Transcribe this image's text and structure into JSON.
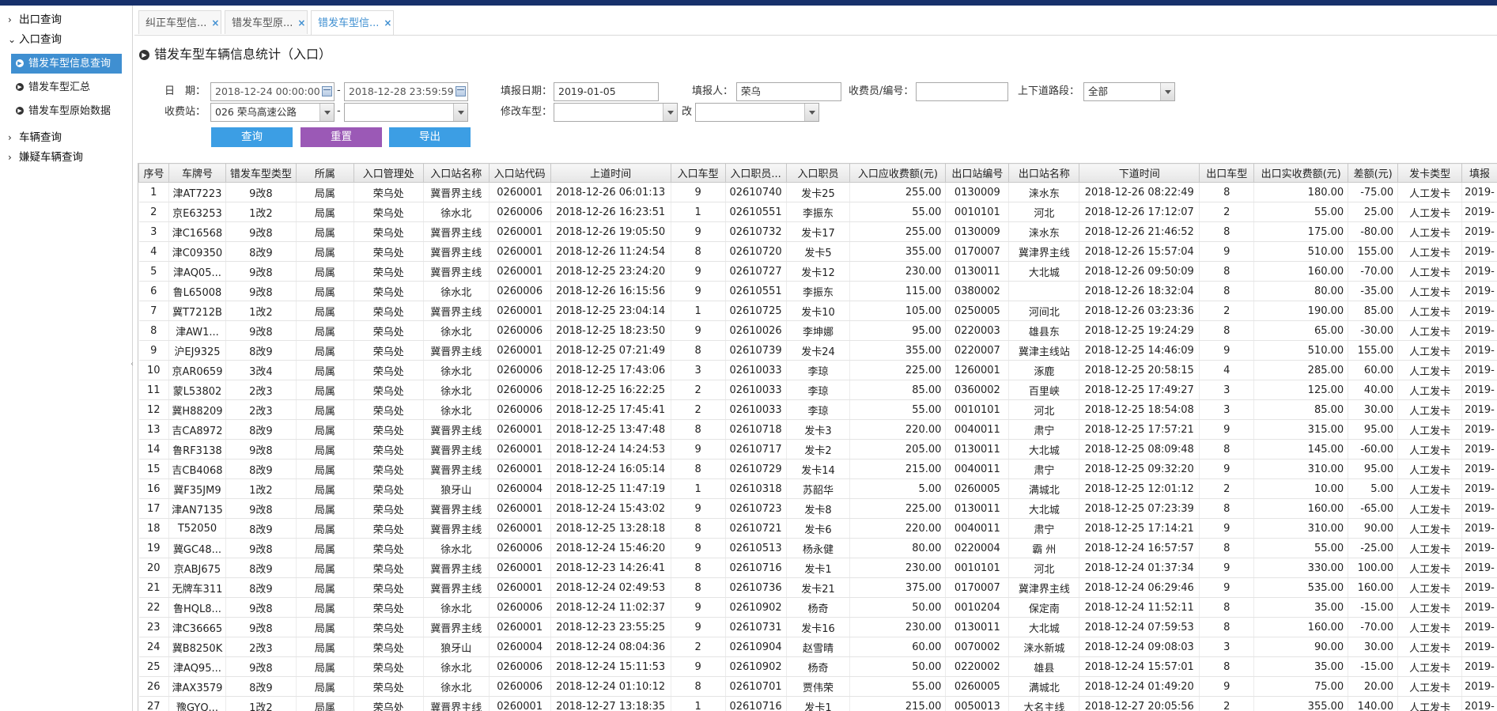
{
  "sidebar": {
    "items": [
      {
        "label": "出口查询",
        "chevron": "›"
      },
      {
        "label": "入口查询",
        "chevron": "⌄"
      },
      {
        "label": "车辆查询",
        "chevron": "›"
      },
      {
        "label": "嫌疑车辆查询",
        "chevron": "›"
      }
    ],
    "sub_items": [
      {
        "label": "错发车型信息查询",
        "active": true
      },
      {
        "label": "错发车型汇总",
        "active": false
      },
      {
        "label": "错发车型原始数据",
        "active": false
      }
    ]
  },
  "tabs": [
    {
      "label": "纠正车型信...",
      "close": "×"
    },
    {
      "label": "错发车型原...",
      "close": "×"
    },
    {
      "label": "错发车型信...",
      "close": "×"
    }
  ],
  "page": {
    "title": "错发车型车辆信息统计（入口）"
  },
  "form": {
    "date_label": "日　期：",
    "date_from": "2018-12-24 00:00:00",
    "date_to": "2018-12-28 23:59:59",
    "dash": "-",
    "report_date_label": "填报日期：",
    "report_date": "2019-01-05",
    "reporter_label": "填报人：",
    "reporter": "荣乌",
    "collector_label": "收费员/编号：",
    "collector": "",
    "section_label": "上下道路段：",
    "section": "全部",
    "station_label": "收费站：",
    "station": "026 荣乌高速公路",
    "station2": "",
    "modify_label": "修改车型：",
    "modify_from": "",
    "modify_to_label": "改",
    "modify_to": "",
    "query_button": "查询",
    "reset_button": "重置",
    "export_button": "导出"
  },
  "table": {
    "columns": [
      "序号",
      "车牌号",
      "错发车型类型",
      "所属",
      "入口管理处",
      "入口站名称",
      "入口站代码",
      "上道时间",
      "入口车型",
      "入口职员...",
      "入口职员",
      "入口应收费额(元)",
      "出口站编号",
      "出口站名称",
      "下道时间",
      "出口车型",
      "出口实收费额(元)",
      "差额(元)",
      "发卡类型",
      "填报"
    ],
    "rows": [
      [
        "1",
        "津AT7223",
        "9改8",
        "局属",
        "荣乌处",
        "冀晋界主线",
        "0260001",
        "2018-12-26 06:01:13",
        "9",
        "02610740",
        "发卡25",
        "255.00",
        "0130009",
        "涞水东",
        "2018-12-26 08:22:49",
        "8",
        "180.00",
        "-75.00",
        "人工发卡",
        "2019-"
      ],
      [
        "2",
        "京E63253",
        "1改2",
        "局属",
        "荣乌处",
        "徐水北",
        "0260006",
        "2018-12-26 16:23:51",
        "1",
        "02610551",
        "李振东",
        "55.00",
        "0010101",
        "河北",
        "2018-12-26 17:12:07",
        "2",
        "55.00",
        "25.00",
        "人工发卡",
        "2019-"
      ],
      [
        "3",
        "津C16568",
        "9改8",
        "局属",
        "荣乌处",
        "冀晋界主线",
        "0260001",
        "2018-12-26 19:05:50",
        "9",
        "02610732",
        "发卡17",
        "255.00",
        "0130009",
        "涞水东",
        "2018-12-26 21:46:52",
        "8",
        "175.00",
        "-80.00",
        "人工发卡",
        "2019-"
      ],
      [
        "4",
        "津C09350",
        "8改9",
        "局属",
        "荣乌处",
        "冀晋界主线",
        "0260001",
        "2018-12-26 11:24:54",
        "8",
        "02610720",
        "发卡5",
        "355.00",
        "0170007",
        "冀津界主线",
        "2018-12-26 15:57:04",
        "9",
        "510.00",
        "155.00",
        "人工发卡",
        "2019-"
      ],
      [
        "5",
        "津AQ05...",
        "9改8",
        "局属",
        "荣乌处",
        "冀晋界主线",
        "0260001",
        "2018-12-25 23:24:20",
        "9",
        "02610727",
        "发卡12",
        "230.00",
        "0130011",
        "大北城",
        "2018-12-26 09:50:09",
        "8",
        "160.00",
        "-70.00",
        "人工发卡",
        "2019-"
      ],
      [
        "6",
        "鲁L65008",
        "9改8",
        "局属",
        "荣乌处",
        "徐水北",
        "0260006",
        "2018-12-26 16:15:56",
        "9",
        "02610551",
        "李振东",
        "115.00",
        "0380002",
        "",
        "2018-12-26 18:32:04",
        "8",
        "80.00",
        "-35.00",
        "人工发卡",
        "2019-"
      ],
      [
        "7",
        "冀T7212B",
        "1改2",
        "局属",
        "荣乌处",
        "冀晋界主线",
        "0260001",
        "2018-12-25 23:04:14",
        "1",
        "02610725",
        "发卡10",
        "105.00",
        "0250005",
        "河间北",
        "2018-12-26 03:23:36",
        "2",
        "190.00",
        "85.00",
        "人工发卡",
        "2019-"
      ],
      [
        "8",
        "津AW1...",
        "9改8",
        "局属",
        "荣乌处",
        "徐水北",
        "0260006",
        "2018-12-25 18:23:50",
        "9",
        "02610026",
        "李坤娜",
        "95.00",
        "0220003",
        "雄县东",
        "2018-12-25 19:24:29",
        "8",
        "65.00",
        "-30.00",
        "人工发卡",
        "2019-"
      ],
      [
        "9",
        "沪EJ9325",
        "8改9",
        "局属",
        "荣乌处",
        "冀晋界主线",
        "0260001",
        "2018-12-25 07:21:49",
        "8",
        "02610739",
        "发卡24",
        "355.00",
        "0220007",
        "冀津主线站",
        "2018-12-25 14:46:09",
        "9",
        "510.00",
        "155.00",
        "人工发卡",
        "2019-"
      ],
      [
        "10",
        "京AR0659",
        "3改4",
        "局属",
        "荣乌处",
        "徐水北",
        "0260006",
        "2018-12-25 17:43:06",
        "3",
        "02610033",
        "李琼",
        "225.00",
        "1260001",
        "涿鹿",
        "2018-12-25 20:58:15",
        "4",
        "285.00",
        "60.00",
        "人工发卡",
        "2019-"
      ],
      [
        "11",
        "蒙L53802",
        "2改3",
        "局属",
        "荣乌处",
        "徐水北",
        "0260006",
        "2018-12-25 16:22:25",
        "2",
        "02610033",
        "李琼",
        "85.00",
        "0360002",
        "百里峡",
        "2018-12-25 17:49:27",
        "3",
        "125.00",
        "40.00",
        "人工发卡",
        "2019-"
      ],
      [
        "12",
        "冀H88209",
        "2改3",
        "局属",
        "荣乌处",
        "徐水北",
        "0260006",
        "2018-12-25 17:45:41",
        "2",
        "02610033",
        "李琼",
        "55.00",
        "0010101",
        "河北",
        "2018-12-25 18:54:08",
        "3",
        "85.00",
        "30.00",
        "人工发卡",
        "2019-"
      ],
      [
        "13",
        "吉CA8972",
        "8改9",
        "局属",
        "荣乌处",
        "冀晋界主线",
        "0260001",
        "2018-12-25 13:47:48",
        "8",
        "02610718",
        "发卡3",
        "220.00",
        "0040011",
        "肃宁",
        "2018-12-25 17:57:21",
        "9",
        "315.00",
        "95.00",
        "人工发卡",
        "2019-"
      ],
      [
        "14",
        "鲁RF3138",
        "9改8",
        "局属",
        "荣乌处",
        "冀晋界主线",
        "0260001",
        "2018-12-24 14:24:53",
        "9",
        "02610717",
        "发卡2",
        "205.00",
        "0130011",
        "大北城",
        "2018-12-25 08:09:48",
        "8",
        "145.00",
        "-60.00",
        "人工发卡",
        "2019-"
      ],
      [
        "15",
        "吉CB4068",
        "8改9",
        "局属",
        "荣乌处",
        "冀晋界主线",
        "0260001",
        "2018-12-24 16:05:14",
        "8",
        "02610729",
        "发卡14",
        "215.00",
        "0040011",
        "肃宁",
        "2018-12-25 09:32:20",
        "9",
        "310.00",
        "95.00",
        "人工发卡",
        "2019-"
      ],
      [
        "16",
        "冀F35JM9",
        "1改2",
        "局属",
        "荣乌处",
        "狼牙山",
        "0260004",
        "2018-12-25 11:47:19",
        "1",
        "02610318",
        "苏韶华",
        "5.00",
        "0260005",
        "满城北",
        "2018-12-25 12:01:12",
        "2",
        "10.00",
        "5.00",
        "人工发卡",
        "2019-"
      ],
      [
        "17",
        "津AN7135",
        "9改8",
        "局属",
        "荣乌处",
        "冀晋界主线",
        "0260001",
        "2018-12-24 15:43:02",
        "9",
        "02610723",
        "发卡8",
        "225.00",
        "0130011",
        "大北城",
        "2018-12-25 07:23:39",
        "8",
        "160.00",
        "-65.00",
        "人工发卡",
        "2019-"
      ],
      [
        "18",
        "T52050",
        "8改9",
        "局属",
        "荣乌处",
        "冀晋界主线",
        "0260001",
        "2018-12-25 13:28:18",
        "8",
        "02610721",
        "发卡6",
        "220.00",
        "0040011",
        "肃宁",
        "2018-12-25 17:14:21",
        "9",
        "310.00",
        "90.00",
        "人工发卡",
        "2019-"
      ],
      [
        "19",
        "冀GC48...",
        "9改8",
        "局属",
        "荣乌处",
        "徐水北",
        "0260006",
        "2018-12-24 15:46:20",
        "9",
        "02610513",
        "杨永健",
        "80.00",
        "0220004",
        "霸 州",
        "2018-12-24 16:57:57",
        "8",
        "55.00",
        "-25.00",
        "人工发卡",
        "2019-"
      ],
      [
        "20",
        "京ABJ675",
        "8改9",
        "局属",
        "荣乌处",
        "冀晋界主线",
        "0260001",
        "2018-12-23 14:26:41",
        "8",
        "02610716",
        "发卡1",
        "230.00",
        "0010101",
        "河北",
        "2018-12-24 01:37:34",
        "9",
        "330.00",
        "100.00",
        "人工发卡",
        "2019-"
      ],
      [
        "21",
        "无牌车311",
        "8改9",
        "局属",
        "荣乌处",
        "冀晋界主线",
        "0260001",
        "2018-12-24 02:49:53",
        "8",
        "02610736",
        "发卡21",
        "375.00",
        "0170007",
        "冀津界主线",
        "2018-12-24 06:29:46",
        "9",
        "535.00",
        "160.00",
        "人工发卡",
        "2019-"
      ],
      [
        "22",
        "鲁HQL8...",
        "9改8",
        "局属",
        "荣乌处",
        "徐水北",
        "0260006",
        "2018-12-24 11:02:37",
        "9",
        "02610902",
        "杨奇",
        "50.00",
        "0010204",
        "保定南",
        "2018-12-24 11:52:11",
        "8",
        "35.00",
        "-15.00",
        "人工发卡",
        "2019-"
      ],
      [
        "23",
        "津C36665",
        "9改8",
        "局属",
        "荣乌处",
        "冀晋界主线",
        "0260001",
        "2018-12-23 23:55:25",
        "9",
        "02610731",
        "发卡16",
        "230.00",
        "0130011",
        "大北城",
        "2018-12-24 07:59:53",
        "8",
        "160.00",
        "-70.00",
        "人工发卡",
        "2019-"
      ],
      [
        "24",
        "冀B8250K",
        "2改3",
        "局属",
        "荣乌处",
        "狼牙山",
        "0260004",
        "2018-12-24 08:04:36",
        "2",
        "02610904",
        "赵雪晴",
        "60.00",
        "0070002",
        "涞水新城",
        "2018-12-24 09:08:03",
        "3",
        "90.00",
        "30.00",
        "人工发卡",
        "2019-"
      ],
      [
        "25",
        "津AQ95...",
        "9改8",
        "局属",
        "荣乌处",
        "徐水北",
        "0260006",
        "2018-12-24 15:11:53",
        "9",
        "02610902",
        "杨奇",
        "50.00",
        "0220002",
        "雄县",
        "2018-12-24 15:57:01",
        "8",
        "35.00",
        "-15.00",
        "人工发卡",
        "2019-"
      ],
      [
        "26",
        "津AX3579",
        "8改9",
        "局属",
        "荣乌处",
        "徐水北",
        "0260006",
        "2018-12-24 01:10:12",
        "8",
        "02610701",
        "贾伟荣",
        "55.00",
        "0260005",
        "满城北",
        "2018-12-24 01:49:20",
        "9",
        "75.00",
        "20.00",
        "人工发卡",
        "2019-"
      ],
      [
        "27",
        "豫GYQ...",
        "1改2",
        "局属",
        "荣乌处",
        "冀晋界主线",
        "0260001",
        "2018-12-27 13:18:35",
        "1",
        "02610716",
        "发卡1",
        "215.00",
        "0050013",
        "大名主线",
        "2018-12-27 20:05:56",
        "2",
        "355.00",
        "140.00",
        "人工发卡",
        "2019-"
      ]
    ]
  }
}
